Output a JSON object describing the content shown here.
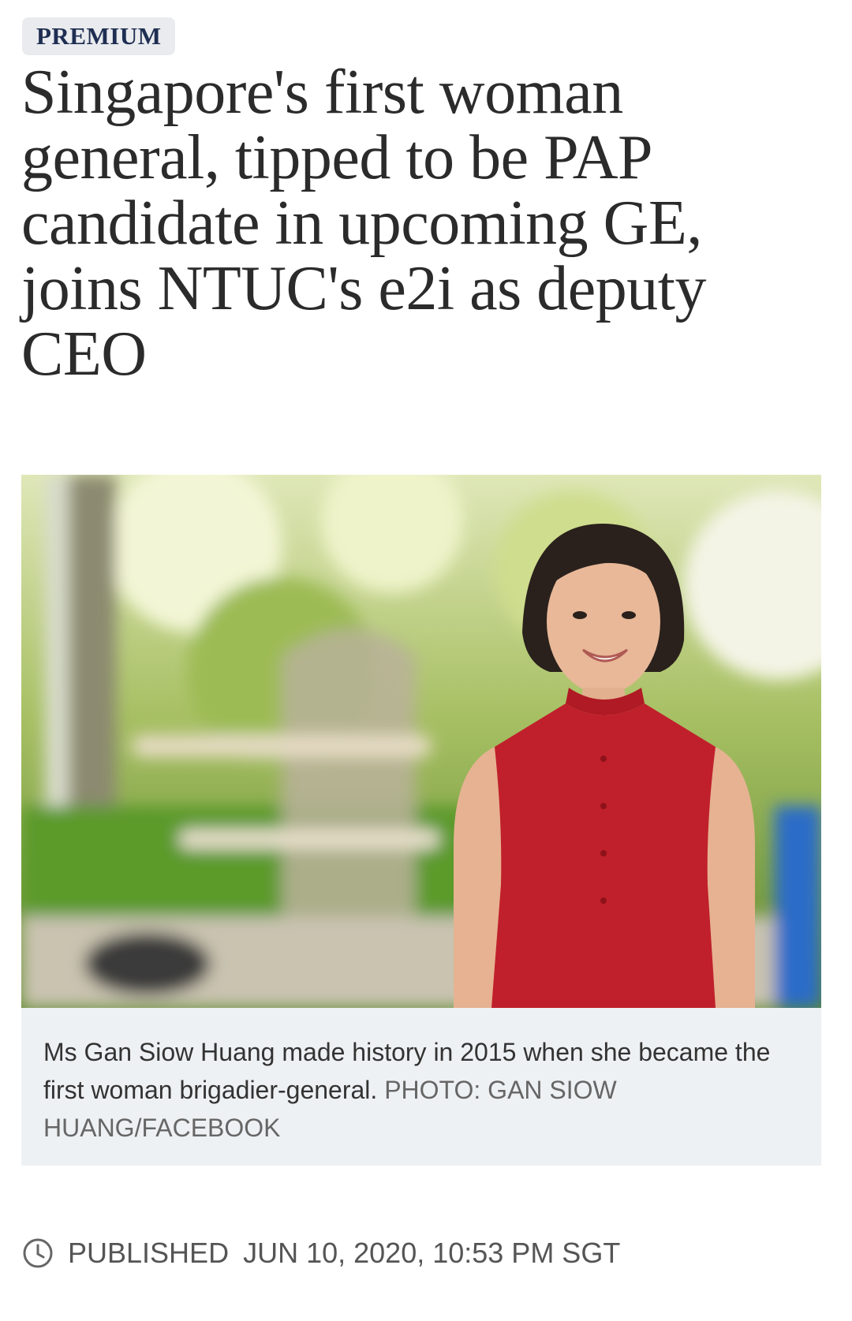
{
  "article": {
    "badge": "PREMIUM",
    "headline": "Singapore's first woman general, tipped to be PAP candidate in upcoming GE, joins NTUC's e2i as deputy CEO",
    "image": {
      "caption": "Ms Gan Siow Huang made history in 2015 when she became the first woman brigadier-general.",
      "credit": "PHOTO: GAN SIOW HUANG/FACEBOOK"
    },
    "published": {
      "icon": "clock-icon",
      "label": "PUBLISHED",
      "datetime": "JUN 10, 2020, 10:53 PM SGT"
    }
  },
  "colors": {
    "badge_bg": "#e9ebee",
    "badge_text": "#1f2e52",
    "caption_bg": "#eef1f3",
    "dress_red": "#c0202b"
  }
}
